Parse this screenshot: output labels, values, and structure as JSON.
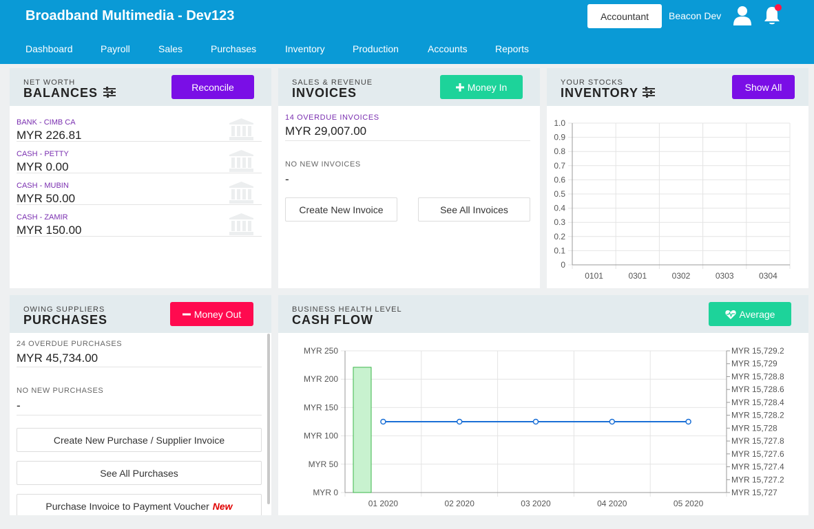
{
  "header": {
    "title": "Broadband Multimedia - Dev123",
    "role_button": "Accountant",
    "user_name": "Beacon Dev",
    "nav": [
      "Dashboard",
      "Payroll",
      "Sales",
      "Purchases",
      "Inventory",
      "Production",
      "Accounts",
      "Reports"
    ],
    "notification_dot_color": "#ff1744"
  },
  "balances": {
    "kicker": "NET WORTH",
    "title": "BALANCES",
    "button": "Reconcile",
    "button_color": "#7a0ee6",
    "accounts": [
      {
        "name": "BANK - CIMB CA",
        "value": "MYR 226.81",
        "icon": "bank-icon"
      },
      {
        "name": "CASH - PETTY",
        "value": "MYR 0.00",
        "icon": "bank-icon"
      },
      {
        "name": "CASH - MUBIN",
        "value": "MYR 50.00",
        "icon": "bank-icon"
      },
      {
        "name": "CASH - ZAMIR",
        "value": "MYR 150.00",
        "icon": "bank-icon"
      }
    ]
  },
  "invoices": {
    "kicker": "SALES & REVENUE",
    "title": "INVOICES",
    "button": "Money In",
    "button_color": "#1dd39a",
    "overdue_label": "14 OVERDUE INVOICES",
    "overdue_value": "MYR 29,007.00",
    "new_label": "NO NEW INVOICES",
    "new_value": "-",
    "create_button": "Create New Invoice",
    "see_all_button": "See All Invoices"
  },
  "inventory": {
    "kicker": "YOUR STOCKS",
    "title": "INVENTORY",
    "button": "Show All",
    "button_color": "#7a0ee6",
    "chart_data": {
      "type": "bar",
      "categories": [
        "0101",
        "0301",
        "0302",
        "0303",
        "0304"
      ],
      "values": [
        0,
        0,
        0,
        0,
        0
      ],
      "y_ticks": [
        "1.0",
        "0.9",
        "0.8",
        "0.7",
        "0.6",
        "0.5",
        "0.4",
        "0.3",
        "0.2",
        "0.1",
        "0"
      ],
      "ylim": [
        0,
        1
      ],
      "grid": true
    }
  },
  "purchases": {
    "kicker": "OWING SUPPLIERS",
    "title": "PURCHASES",
    "button": "Money Out",
    "button_color": "#ff0a4f",
    "overdue_label": "24 OVERDUE PURCHASES",
    "overdue_value": "MYR 45,734.00",
    "new_label": "NO NEW PURCHASES",
    "new_value": "-",
    "create_button": "Create New Purchase / Supplier Invoice",
    "see_all_button": "See All Purchases",
    "voucher_button": "Purchase Invoice to Payment Voucher",
    "voucher_tag": "New"
  },
  "cashflow": {
    "kicker": "BUSINESS HEALTH LEVEL",
    "title": "CASH FLOW",
    "button": "Average",
    "button_color": "#1dd39a",
    "chart_data": {
      "type": "bar",
      "categories": [
        "01 2020",
        "02 2020",
        "03 2020",
        "04 2020",
        "05 2020"
      ],
      "series": [
        {
          "type": "bar",
          "axis": "left",
          "values": [
            221,
            0,
            0,
            0,
            0
          ],
          "color": "#c8f2cf",
          "stroke": "#3bb54a"
        },
        {
          "type": "line",
          "axis": "right",
          "values": [
            15728.1,
            15728.1,
            15728.1,
            15728.1,
            15728.1
          ],
          "color": "#1a6fd6"
        }
      ],
      "y_left_ticks": [
        "MYR 250",
        "MYR 200",
        "MYR 150",
        "MYR 100",
        "MYR 50",
        "MYR 0"
      ],
      "ylim_left": [
        0,
        250
      ],
      "y_right_ticks": [
        "MYR 15,729.2",
        "MYR 15,729",
        "MYR 15,728.8",
        "MYR 15,728.6",
        "MYR 15,728.4",
        "MYR 15,728.2",
        "MYR 15,728",
        "MYR 15,727.8",
        "MYR 15,727.6",
        "MYR 15,727.4",
        "MYR 15,727.2",
        "MYR 15,727"
      ],
      "ylim_right": [
        15727,
        15729.2
      ],
      "grid": true
    }
  }
}
